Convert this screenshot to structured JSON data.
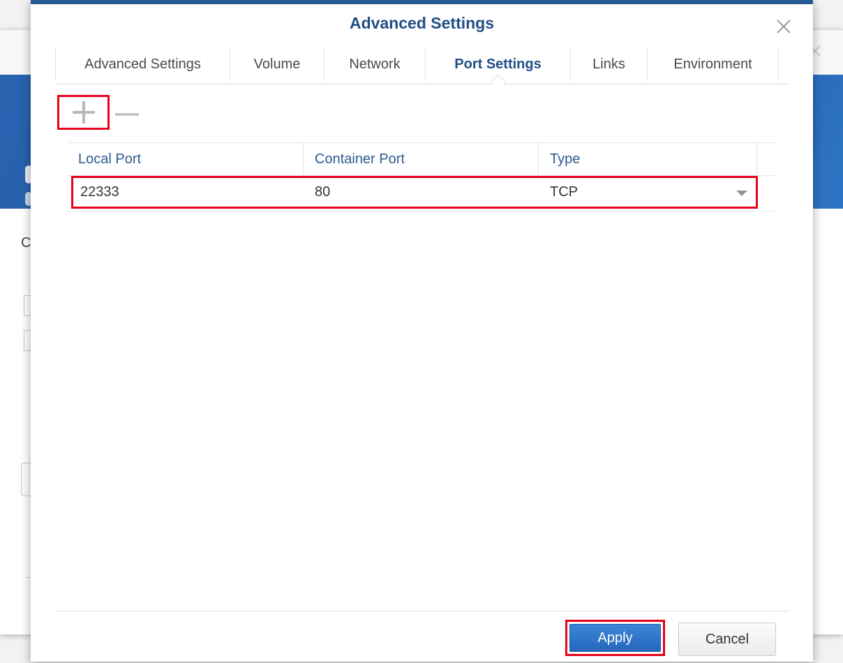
{
  "dialog": {
    "title": "Advanced Settings"
  },
  "tabs": [
    {
      "label": "Advanced Settings",
      "active": false
    },
    {
      "label": "Volume",
      "active": false
    },
    {
      "label": "Network",
      "active": false
    },
    {
      "label": "Port Settings",
      "active": true
    },
    {
      "label": "Links",
      "active": false
    },
    {
      "label": "Environment",
      "active": false
    }
  ],
  "toolbar": {
    "add_icon": "plus-icon",
    "remove_icon": "minus-icon"
  },
  "grid": {
    "columns": [
      "Local Port",
      "Container Port",
      "Type"
    ],
    "rows": [
      {
        "local_port": "22333",
        "container_port": "80",
        "type": "TCP"
      }
    ]
  },
  "footer": {
    "apply_label": "Apply",
    "cancel_label": "Cancel"
  },
  "background": {
    "partial_label": "C"
  },
  "colors": {
    "accent": "#1f4e86",
    "highlight": "#e8001b",
    "primary_button": "#2467bd",
    "banner": "#1d5aa8"
  }
}
